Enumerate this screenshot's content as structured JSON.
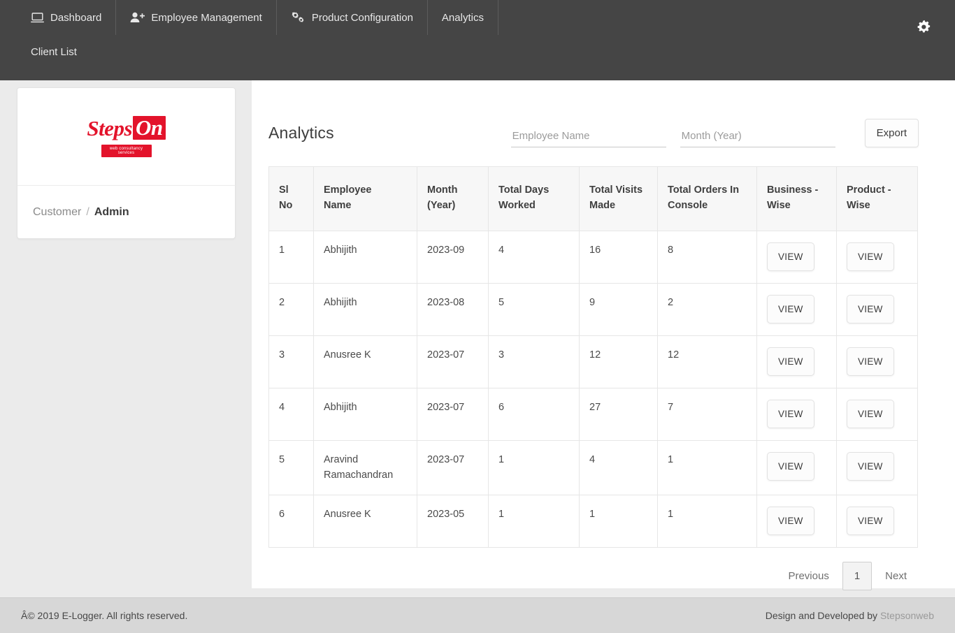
{
  "navbar": {
    "items": [
      {
        "label": "Dashboard",
        "icon": "laptop-icon"
      },
      {
        "label": "Employee Management",
        "icon": "user-plus-icon"
      },
      {
        "label": "Product Configuration",
        "icon": "cogs-icon"
      },
      {
        "label": "Analytics",
        "icon": ""
      },
      {
        "label": "Client List",
        "icon": ""
      }
    ],
    "settings_icon": "gear-icon",
    "bg_color": "#454545"
  },
  "sidebar": {
    "logo": {
      "text_main": "Steps",
      "text_box": "On",
      "tagline": "web consultancy services",
      "color": "#e3132b"
    },
    "breadcrumb": {
      "first": "Customer",
      "separator": "/",
      "last": "Admin"
    }
  },
  "main": {
    "title": "Analytics",
    "filters": {
      "employee_placeholder": "Employee Name",
      "employee_value": "",
      "month_placeholder": "Month (Year)",
      "month_value": ""
    },
    "export_label": "Export",
    "table": {
      "headers": [
        "Sl No",
        "Employee Name",
        "Month (Year)",
        "Total Days Worked",
        "Total Visits Made",
        "Total Orders In Console",
        "Business - Wise",
        "Product - Wise"
      ],
      "header_lines": [
        [
          "Sl",
          "No"
        ],
        [
          "Employee",
          "Name"
        ],
        [
          "Month",
          "(Year)"
        ],
        [
          "Total Days",
          "Worked"
        ],
        [
          "Total Visits",
          "Made"
        ],
        [
          "Total Orders In",
          "Console"
        ],
        [
          "Business -",
          "Wise"
        ],
        [
          "Product -",
          "Wise"
        ]
      ],
      "button_label": "VIEW",
      "rows": [
        {
          "sl": "1",
          "employee": "Abhijith",
          "month": "2023-09",
          "days": "4",
          "visits": "16",
          "orders": "8",
          "business": "VIEW",
          "product": "VIEW"
        },
        {
          "sl": "2",
          "employee": "Abhijith",
          "month": "2023-08",
          "days": "5",
          "visits": "9",
          "orders": "2",
          "business": "VIEW",
          "product": "VIEW"
        },
        {
          "sl": "3",
          "employee": "Anusree K",
          "month": "2023-07",
          "days": "3",
          "visits": "12",
          "orders": "12",
          "business": "VIEW",
          "product": "VIEW"
        },
        {
          "sl": "4",
          "employee": "Abhijith",
          "month": "2023-07",
          "days": "6",
          "visits": "27",
          "orders": "7",
          "business": "VIEW",
          "product": "VIEW"
        },
        {
          "sl": "5",
          "employee": "Aravind Ramachandran",
          "month": "2023-07",
          "days": "1",
          "visits": "4",
          "orders": "1",
          "business": "VIEW",
          "product": "VIEW"
        },
        {
          "sl": "6",
          "employee": "Anusree K",
          "month": "2023-05",
          "days": "1",
          "visits": "1",
          "orders": "1",
          "business": "VIEW",
          "product": "VIEW"
        }
      ]
    },
    "pagination": {
      "previous": "Previous",
      "current_page": "1",
      "next": "Next"
    }
  },
  "footer": {
    "left": "Â© 2019 E-Logger. All rights reserved.",
    "right_text": "Design and Developed by",
    "right_link": "Stepsonweb"
  }
}
